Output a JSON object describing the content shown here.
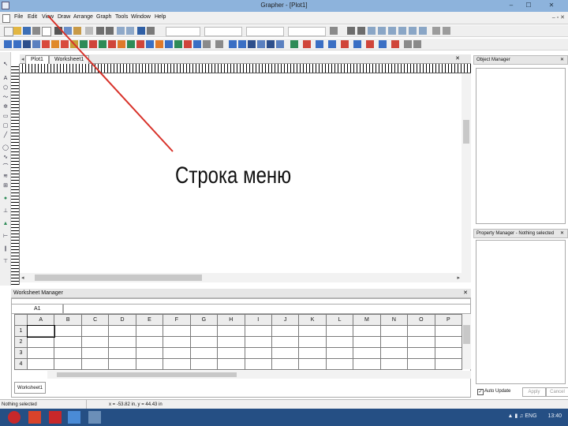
{
  "window": {
    "title": "Grapher - [Plot1]",
    "controls": [
      "–",
      "☐",
      "✕"
    ]
  },
  "menu": [
    "File",
    "Edit",
    "View",
    "Draw",
    "Arrange",
    "Graph",
    "Tools",
    "Window",
    "Help"
  ],
  "menu_controls": "– ▫ ✕",
  "document_tabs": [
    "Plot1",
    "Worksheet1"
  ],
  "annotation": "Строка меню",
  "worksheet_manager": {
    "title": "Worksheet Manager",
    "cell_ref": "A1",
    "columns": [
      "A",
      "B",
      "C",
      "D",
      "E",
      "F",
      "G",
      "H",
      "I",
      "J",
      "K",
      "L",
      "M",
      "N",
      "O",
      "P"
    ],
    "rows": [
      "1",
      "2",
      "3",
      "4"
    ],
    "tab": "Worksheet1"
  },
  "object_manager": {
    "title": "Object Manager"
  },
  "property_manager": {
    "title": "Property Manager - Nothing selected",
    "auto_update": "Auto Update",
    "apply": "Apply",
    "cancel": "Cancel"
  },
  "status": {
    "message": "Nothing selected",
    "coords": "x = -53.82 in, y = 44.43 in"
  },
  "taskbar": {
    "lang": "ENG",
    "time": "13:40"
  },
  "colors": {
    "titlebar": "#8db3dc",
    "taskbar": "#254f84",
    "pointer_line": "#d8322a"
  }
}
